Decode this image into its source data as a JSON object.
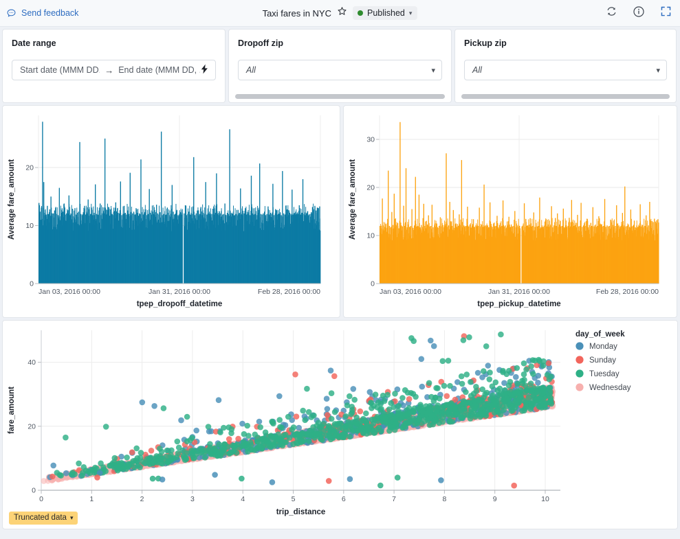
{
  "header": {
    "feedback_label": "Send feedback",
    "feedback_icon": "comment-icon",
    "title": "Taxi fares in NYC",
    "star_icon": "star-icon",
    "status_label": "Published",
    "status_color": "#2e8b2e",
    "status_caret_icon": "chevron-down-icon",
    "icons": [
      "refresh-icon",
      "info-icon",
      "fullscreen-icon"
    ]
  },
  "filters": [
    {
      "name": "date-range",
      "label": "Date range",
      "start_placeholder": "Start date (MMM DD...",
      "arrow": "→",
      "end_placeholder": "End date (MMM DD, ...",
      "action_icon": "lightning-bolt-icon"
    },
    {
      "name": "dropoff-zip",
      "label": "Dropoff zip",
      "value": "All",
      "caret_icon": "chevron-down-icon"
    },
    {
      "name": "pickup-zip",
      "label": "Pickup zip",
      "value": "All",
      "caret_icon": "chevron-down-icon"
    }
  ],
  "chart_data": [
    {
      "type": "bar",
      "name": "dropoff-bar-chart",
      "title": "",
      "xlabel": "tpep_dropoff_datetime",
      "ylabel": "Average fare_amount",
      "color": "#0c7ba4",
      "xticks": [
        "Jan 03, 2016 00:00",
        "Jan 31, 2016 00:00",
        "Feb 28, 2016 00:00"
      ],
      "yticks": [
        0,
        10,
        20
      ],
      "ylim": [
        0,
        29
      ],
      "grid": true,
      "n_bars": 240,
      "gap_index": 120,
      "baseline": 11.3,
      "values": [
        13.9,
        12.4,
        13.1,
        27.9,
        17.5,
        12.2,
        11.9,
        13.4,
        12.0,
        12.8,
        15.0,
        11.7,
        12.1,
        12.6,
        13.2,
        12.0,
        11.8,
        16.5,
        11.6,
        12.2,
        12.4,
        13.8,
        11.9,
        12.1,
        12.5,
        15.2,
        11.8,
        12.0,
        12.9,
        11.6,
        13.0,
        11.9,
        12.2,
        12.4,
        24.4,
        12.0,
        11.8,
        12.3,
        13.4,
        11.9,
        12.1,
        14.5,
        11.7,
        12.0,
        13.1,
        11.8,
        12.2,
        17.1,
        12.0,
        11.9,
        12.6,
        13.8,
        11.8,
        12.1,
        12.4,
        25.0,
        11.9,
        12.0,
        13.2,
        11.7,
        12.3,
        12.0,
        11.8,
        12.5,
        14.0,
        11.9,
        12.2,
        12.1,
        17.6,
        11.8,
        12.0,
        13.4,
        12.2,
        11.9,
        12.6,
        12.0,
        19.1,
        11.8,
        12.1,
        12.4,
        11.9,
        13.0,
        12.2,
        11.7,
        12.0,
        21.4,
        12.3,
        11.9,
        12.1,
        12.8,
        11.8,
        12.0,
        16.3,
        12.2,
        11.9,
        12.4,
        12.0,
        11.8,
        13.6,
        12.1,
        11.9,
        12.3,
        26.2,
        11.8,
        12.0,
        12.5,
        11.9,
        13.1,
        12.2,
        11.8,
        12.0,
        17.0,
        12.4,
        11.9,
        12.1,
        12.7,
        11.8,
        12.0,
        12.3,
        11.9,
        0.0,
        12.1,
        13.5,
        11.8,
        12.0,
        12.4,
        11.9,
        12.2,
        12.0,
        21.8,
        11.8,
        12.1,
        12.6,
        11.9,
        12.0,
        13.2,
        11.8,
        12.2,
        12.0,
        17.5,
        11.9,
        12.1,
        12.4,
        11.8,
        12.0,
        12.9,
        11.9,
        12.2,
        19.0,
        12.0,
        11.8,
        12.1,
        12.5,
        11.9,
        12.0,
        13.8,
        11.8,
        12.2,
        12.0,
        26.6,
        11.9,
        12.1,
        12.4,
        11.8,
        12.0,
        12.7,
        11.9,
        12.2,
        16.4,
        12.0,
        11.8,
        12.1,
        13.0,
        11.9,
        12.0,
        12.3,
        11.8,
        18.6,
        12.1,
        11.9,
        12.0,
        12.5,
        11.8,
        12.2,
        20.7,
        12.0,
        11.9,
        12.1,
        12.4,
        11.8,
        12.0,
        13.3,
        11.9,
        12.2,
        12.0,
        17.2,
        11.8,
        12.1,
        12.6,
        11.9,
        12.0,
        12.3,
        11.8,
        19.4,
        12.1,
        11.9,
        12.0,
        12.8,
        11.8,
        12.2,
        12.0,
        16.2,
        11.9,
        12.1,
        12.4,
        11.8,
        12.0,
        13.5,
        11.9,
        12.2,
        18.0,
        12.0,
        11.8,
        12.1,
        12.5,
        11.9,
        12.0,
        12.3,
        13.2,
        12.8,
        13.4,
        12.6,
        13.1,
        13.0,
        13.3
      ]
    },
    {
      "type": "bar",
      "name": "pickup-bar-chart",
      "title": "",
      "xlabel": "tpep_pickup_datetime",
      "ylabel": "Average fare_amount",
      "color": "#fca311",
      "xticks": [
        "Jan 03, 2016 00:00",
        "Jan 31, 2016 00:00",
        "Feb 28, 2016 00:00"
      ],
      "yticks": [
        0,
        10,
        20,
        30
      ],
      "ylim": [
        0,
        35
      ],
      "grid": true,
      "n_bars": 240,
      "gap_index": 120,
      "baseline": 11.2,
      "values": [
        12.0,
        11.5,
        17.7,
        12.1,
        11.8,
        12.4,
        11.6,
        23.5,
        12.0,
        11.7,
        14.9,
        12.2,
        18.7,
        11.8,
        12.0,
        12.6,
        11.5,
        33.6,
        12.1,
        11.9,
        16.2,
        12.0,
        24.0,
        11.7,
        12.3,
        11.8,
        12.0,
        15.5,
        11.6,
        12.1,
        22.2,
        11.9,
        12.0,
        18.5,
        11.7,
        12.2,
        11.8,
        16.6,
        12.0,
        11.5,
        12.3,
        14.2,
        11.9,
        12.0,
        16.4,
        11.7,
        12.1,
        11.8,
        12.5,
        11.6,
        12.0,
        13.8,
        11.9,
        12.2,
        11.7,
        12.0,
        27.1,
        11.8,
        12.1,
        17.0,
        11.9,
        12.0,
        15.3,
        11.6,
        12.2,
        11.8,
        12.0,
        14.4,
        11.9,
        25.7,
        11.7,
        12.1,
        11.8,
        12.0,
        16.0,
        11.9,
        12.3,
        11.6,
        12.0,
        13.4,
        11.8,
        12.1,
        11.9,
        12.0,
        15.8,
        11.7,
        12.2,
        11.8,
        20.6,
        12.0,
        11.9,
        12.1,
        11.7,
        16.9,
        12.0,
        11.8,
        12.4,
        11.9,
        12.0,
        14.1,
        11.7,
        12.2,
        11.8,
        12.0,
        17.3,
        11.9,
        12.1,
        11.6,
        12.0,
        13.9,
        11.8,
        12.3,
        11.9,
        12.0,
        15.1,
        11.7,
        12.1,
        11.8,
        12.0,
        0.0,
        11.9,
        12.2,
        16.7,
        11.8,
        12.0,
        12.1,
        11.7,
        13.6,
        11.9,
        12.0,
        14.8,
        11.8,
        12.2,
        11.9,
        12.0,
        17.9,
        11.7,
        12.1,
        11.8,
        12.0,
        13.2,
        11.9,
        12.3,
        11.8,
        12.0,
        16.1,
        11.7,
        12.1,
        11.9,
        12.0,
        14.6,
        11.8,
        12.2,
        11.9,
        12.0,
        15.6,
        11.7,
        12.1,
        11.8,
        12.0,
        13.7,
        11.9,
        17.4,
        11.8,
        12.0,
        12.2,
        11.7,
        14.3,
        11.9,
        12.0,
        16.8,
        11.8,
        12.1,
        11.9,
        12.0,
        13.5,
        11.7,
        12.2,
        11.8,
        12.0,
        15.9,
        11.9,
        12.1,
        11.8,
        12.0,
        14.0,
        11.7,
        12.3,
        11.9,
        12.0,
        17.6,
        11.8,
        12.1,
        11.9,
        12.0,
        13.3,
        11.7,
        12.2,
        11.8,
        12.0,
        16.3,
        11.9,
        12.1,
        11.8,
        12.0,
        14.7,
        11.7,
        20.2,
        11.9,
        12.0,
        12.2,
        11.8,
        15.4,
        11.9,
        12.0,
        13.1,
        11.7,
        12.1,
        11.8,
        12.0,
        16.5,
        11.9,
        12.2,
        11.8,
        12.0,
        14.2,
        11.7,
        12.1,
        17.0,
        12.0,
        13.0,
        12.8,
        13.5,
        12.9,
        13.2,
        13.4
      ]
    },
    {
      "type": "scatter",
      "name": "fare-vs-distance-scatter",
      "title": "",
      "xlabel": "trip_distance",
      "ylabel": "fare_amount",
      "xticks": [
        0,
        1,
        2,
        3,
        4,
        5,
        6,
        7,
        8,
        9,
        10
      ],
      "yticks": [
        0,
        20,
        40
      ],
      "xlim": [
        0,
        10.3
      ],
      "ylim": [
        0,
        50
      ],
      "grid": true,
      "legend_title": "day_of_week",
      "legend_position": "right",
      "series": [
        {
          "name": "Monday",
          "color": "#4a90b8"
        },
        {
          "name": "Sunday",
          "color": "#f2655c"
        },
        {
          "name": "Tuesday",
          "color": "#2eb086"
        },
        {
          "name": "Wednesday",
          "color": "#f7b0ae"
        }
      ]
    }
  ],
  "footer": {
    "truncated_label": "Truncated data",
    "truncated_caret_icon": "chevron-down-icon",
    "badge_color": "#fcd377"
  }
}
